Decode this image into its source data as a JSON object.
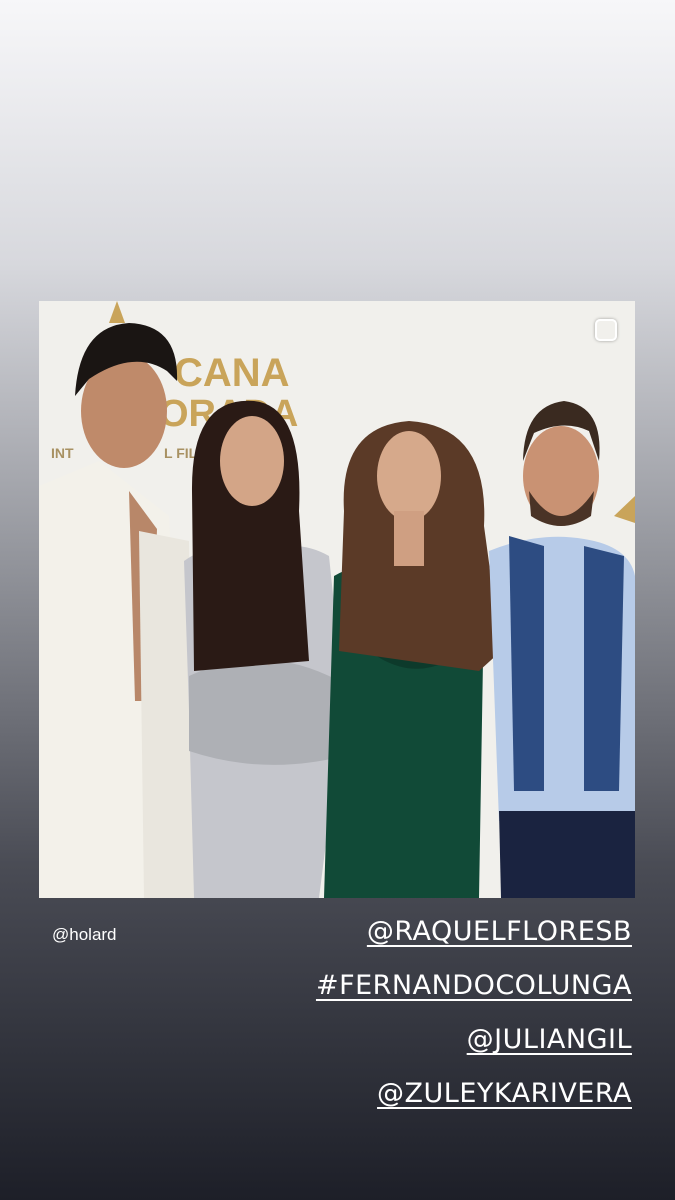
{
  "story": {
    "handle": "@holard",
    "tags": [
      "@RAQUELFLORESB",
      "#FERNANDOCOLUNGA",
      "@JULIANGIL",
      "@ZULEYKARIVERA"
    ]
  },
  "post": {
    "backdrop_text_lines": [
      "CANA",
      "ORADA",
      "INT",
      "L FILM"
    ],
    "icon": "square-icon"
  },
  "colors": {
    "backdrop": "#f1f0ec",
    "logo_gold": "#c9a45a",
    "green_dress": "#114a37",
    "silver_dress": "#c5c6cc",
    "blue_shirt": "#b7cbe8",
    "navy_vest": "#2d4c82"
  }
}
